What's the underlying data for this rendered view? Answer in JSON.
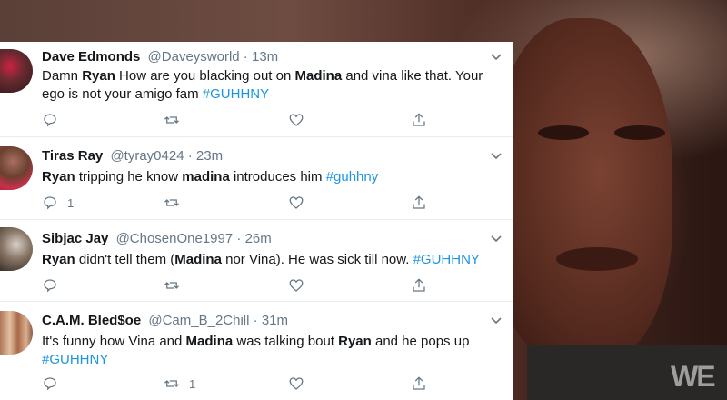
{
  "tweets": [
    {
      "name": "Dave Edmonds",
      "handle": "@Daveysworld",
      "separator": " · ",
      "time": "13m",
      "text_parts": [
        {
          "t": "Damn ",
          "s": "n"
        },
        {
          "t": "Ryan",
          "s": "b"
        },
        {
          "t": " How are you blacking out on ",
          "s": "n"
        },
        {
          "t": "Madina",
          "s": "b"
        },
        {
          "t": " and vina like that. Your ego is not your amigo fam ",
          "s": "n"
        },
        {
          "t": "#GUHHNY",
          "s": "h"
        }
      ],
      "reply_count": "",
      "retweet_count": ""
    },
    {
      "name": "Tiras Ray",
      "handle": "@tyray0424",
      "separator": " · ",
      "time": "23m",
      "text_parts": [
        {
          "t": "Ryan",
          "s": "b"
        },
        {
          "t": " tripping he know ",
          "s": "n"
        },
        {
          "t": "madina",
          "s": "b"
        },
        {
          "t": " introduces him ",
          "s": "n"
        },
        {
          "t": "#guhhny",
          "s": "h"
        }
      ],
      "reply_count": "1",
      "retweet_count": ""
    },
    {
      "name": "Sibjac Jay",
      "handle": "@ChosenOne1997",
      "separator": " · ",
      "time": "26m",
      "text_parts": [
        {
          "t": "Ryan",
          "s": "b"
        },
        {
          "t": " didn't tell them (",
          "s": "n"
        },
        {
          "t": "Madina",
          "s": "b"
        },
        {
          "t": " nor Vina). He was sick till now. ",
          "s": "n"
        },
        {
          "t": "#GUHHNY",
          "s": "h"
        }
      ],
      "reply_count": "",
      "retweet_count": ""
    },
    {
      "name": "C.A.M. Bled$oe",
      "handle": "@Cam_B_2Chill",
      "separator": " · ",
      "time": "31m",
      "text_parts": [
        {
          "t": "It's funny how Vina and ",
          "s": "n"
        },
        {
          "t": "Madina",
          "s": "b"
        },
        {
          "t": " was talking bout ",
          "s": "n"
        },
        {
          "t": "Ryan",
          "s": "b"
        },
        {
          "t": " and he pops up ",
          "s": "n"
        },
        {
          "t": "#GUHHNY",
          "s": "h"
        }
      ],
      "reply_count": "",
      "retweet_count": "1"
    }
  ],
  "icons": {
    "reply": "reply-icon",
    "retweet": "retweet-icon",
    "like": "like-icon",
    "share": "share-icon",
    "menu": "chevron-down-icon"
  },
  "colors": {
    "text": "#14171a",
    "secondary": "#657786",
    "link": "#1b95e0",
    "divider": "#e6ecf0"
  },
  "watermark": "WE"
}
